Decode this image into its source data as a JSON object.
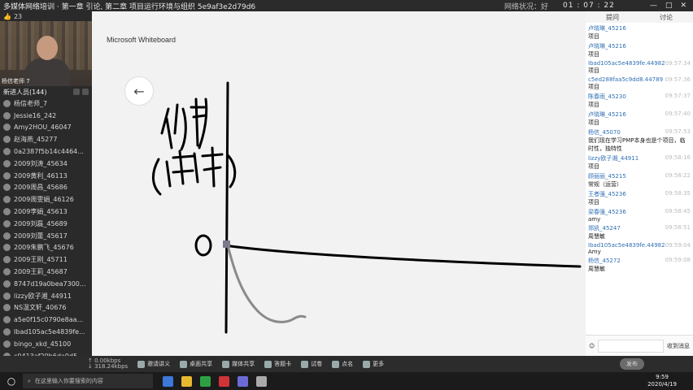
{
  "topbar": {
    "title": "多媒体网络培训 · 第一章 引论, 第二章 项目运行环境与组织 5e9af3e2d79d6",
    "net_status": "网络状况：好",
    "timer": "01 : 07 : 22"
  },
  "left": {
    "likes": "23",
    "camera_caption": "杨信老师 7",
    "list_header": "新进人员(144)",
    "users": [
      "杨信老师_7",
      "Jessie16_242",
      "Amy2HOU_46047",
      "赵海燕_45277",
      "0a2387f5b14c4464...",
      "2009刘涛_45634",
      "2009黄利_46113",
      "2009周昌_45686",
      "2009周雯娟_46126",
      "2009李娟_45613",
      "2009刘磊_45689",
      "2009刘蕾_45617",
      "2009朱鹏飞_45676",
      "2009王刚_45711",
      "2009王莉_45687",
      "8747d19a0bea7300...",
      "lizzy欧子湘_44911",
      "NS温文轩_40676",
      "a5e0f15c0790e8aa...",
      "Ibad105ac5e4839fe...",
      "bingo_xkd_45100",
      "c0413af20b6da0d5..."
    ]
  },
  "board": {
    "app_title": "Microsoft Whiteboard",
    "back_label": "←"
  },
  "chat": {
    "tabs": [
      "提问",
      "讨论"
    ],
    "messages": [
      {
        "user": "卢晓琳_45216",
        "time": "",
        "text": "项目"
      },
      {
        "user": "卢晓琳_45216",
        "time": "",
        "text": "项目"
      },
      {
        "user": "Ibad105ac5e4839fe.44982",
        "time": "09:57:34",
        "text": "项目"
      },
      {
        "user": "c5ed288faa5c9dd8.44789",
        "time": "09:57:36",
        "text": "项目"
      },
      {
        "user": "陈春雨_45230",
        "time": "09:57:37",
        "text": "项目"
      },
      {
        "user": "卢晓琳_45216",
        "time": "09:57:40",
        "text": "项目"
      },
      {
        "user": "杨信_45070",
        "time": "09:57:53",
        "text": "我们现在学习PMP本身也是个项目，临时性，独特性"
      },
      {
        "user": "lizzy欧子湘_44911",
        "time": "09:58:16",
        "text": "项目"
      },
      {
        "user": "顾丽丽_45215",
        "time": "09:58:22",
        "text": "常规（运营）"
      },
      {
        "user": "王者强_45236",
        "time": "09:58:35",
        "text": "项目"
      },
      {
        "user": "梁春强_45236",
        "time": "09:58:45",
        "text": "amy"
      },
      {
        "user": "郑凯_45247",
        "time": "09:58:51",
        "text": "周慧敏"
      },
      {
        "user": "Ibad105ac5e4839fe.44982",
        "time": "09:59:04",
        "text": "Amy"
      },
      {
        "user": "杨信_45272",
        "time": "09:59:08",
        "text": "周慧敏"
      }
    ],
    "footer_label": "收到消息"
  },
  "toolbar": {
    "speed_up": "↑ 0.00kbps",
    "speed_down": "↓ 318.24kbps",
    "tools": [
      "邀请讲义",
      "桌面共享",
      "媒体共享",
      "答题卡",
      "试卷",
      "点名",
      "更多"
    ],
    "publish_label": "发布"
  },
  "taskbar": {
    "search_placeholder": "在这里输入你要搜索的内容",
    "time": "9:59",
    "date": "2020/4/19"
  }
}
